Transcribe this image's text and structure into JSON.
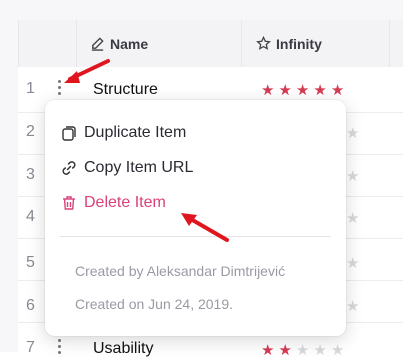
{
  "header": {
    "name_label": "Name",
    "infinity_label": "Infinity"
  },
  "rows": [
    {
      "num": "1",
      "name": "Structure",
      "stars": 5
    },
    {
      "num": "2"
    },
    {
      "num": "3"
    },
    {
      "num": "4"
    },
    {
      "num": "5"
    },
    {
      "num": "6"
    },
    {
      "num": "7",
      "name": "Usability",
      "stars": 2
    }
  ],
  "menu": {
    "duplicate": "Duplicate Item",
    "copy_url": "Copy Item URL",
    "delete": "Delete Item",
    "created_by": "Created by Aleksandar Dimtrijević",
    "created_on": "Created on Jun 24, 2019."
  },
  "colors": {
    "star_active": "#d63b54",
    "delete": "#d9417a",
    "annotation_arrow": "#e0161f"
  },
  "icons": [
    "pencil-icon",
    "star-outline-icon",
    "duplicate-icon",
    "link-icon",
    "trash-icon",
    "more-vertical-icon",
    "star-icon"
  ]
}
